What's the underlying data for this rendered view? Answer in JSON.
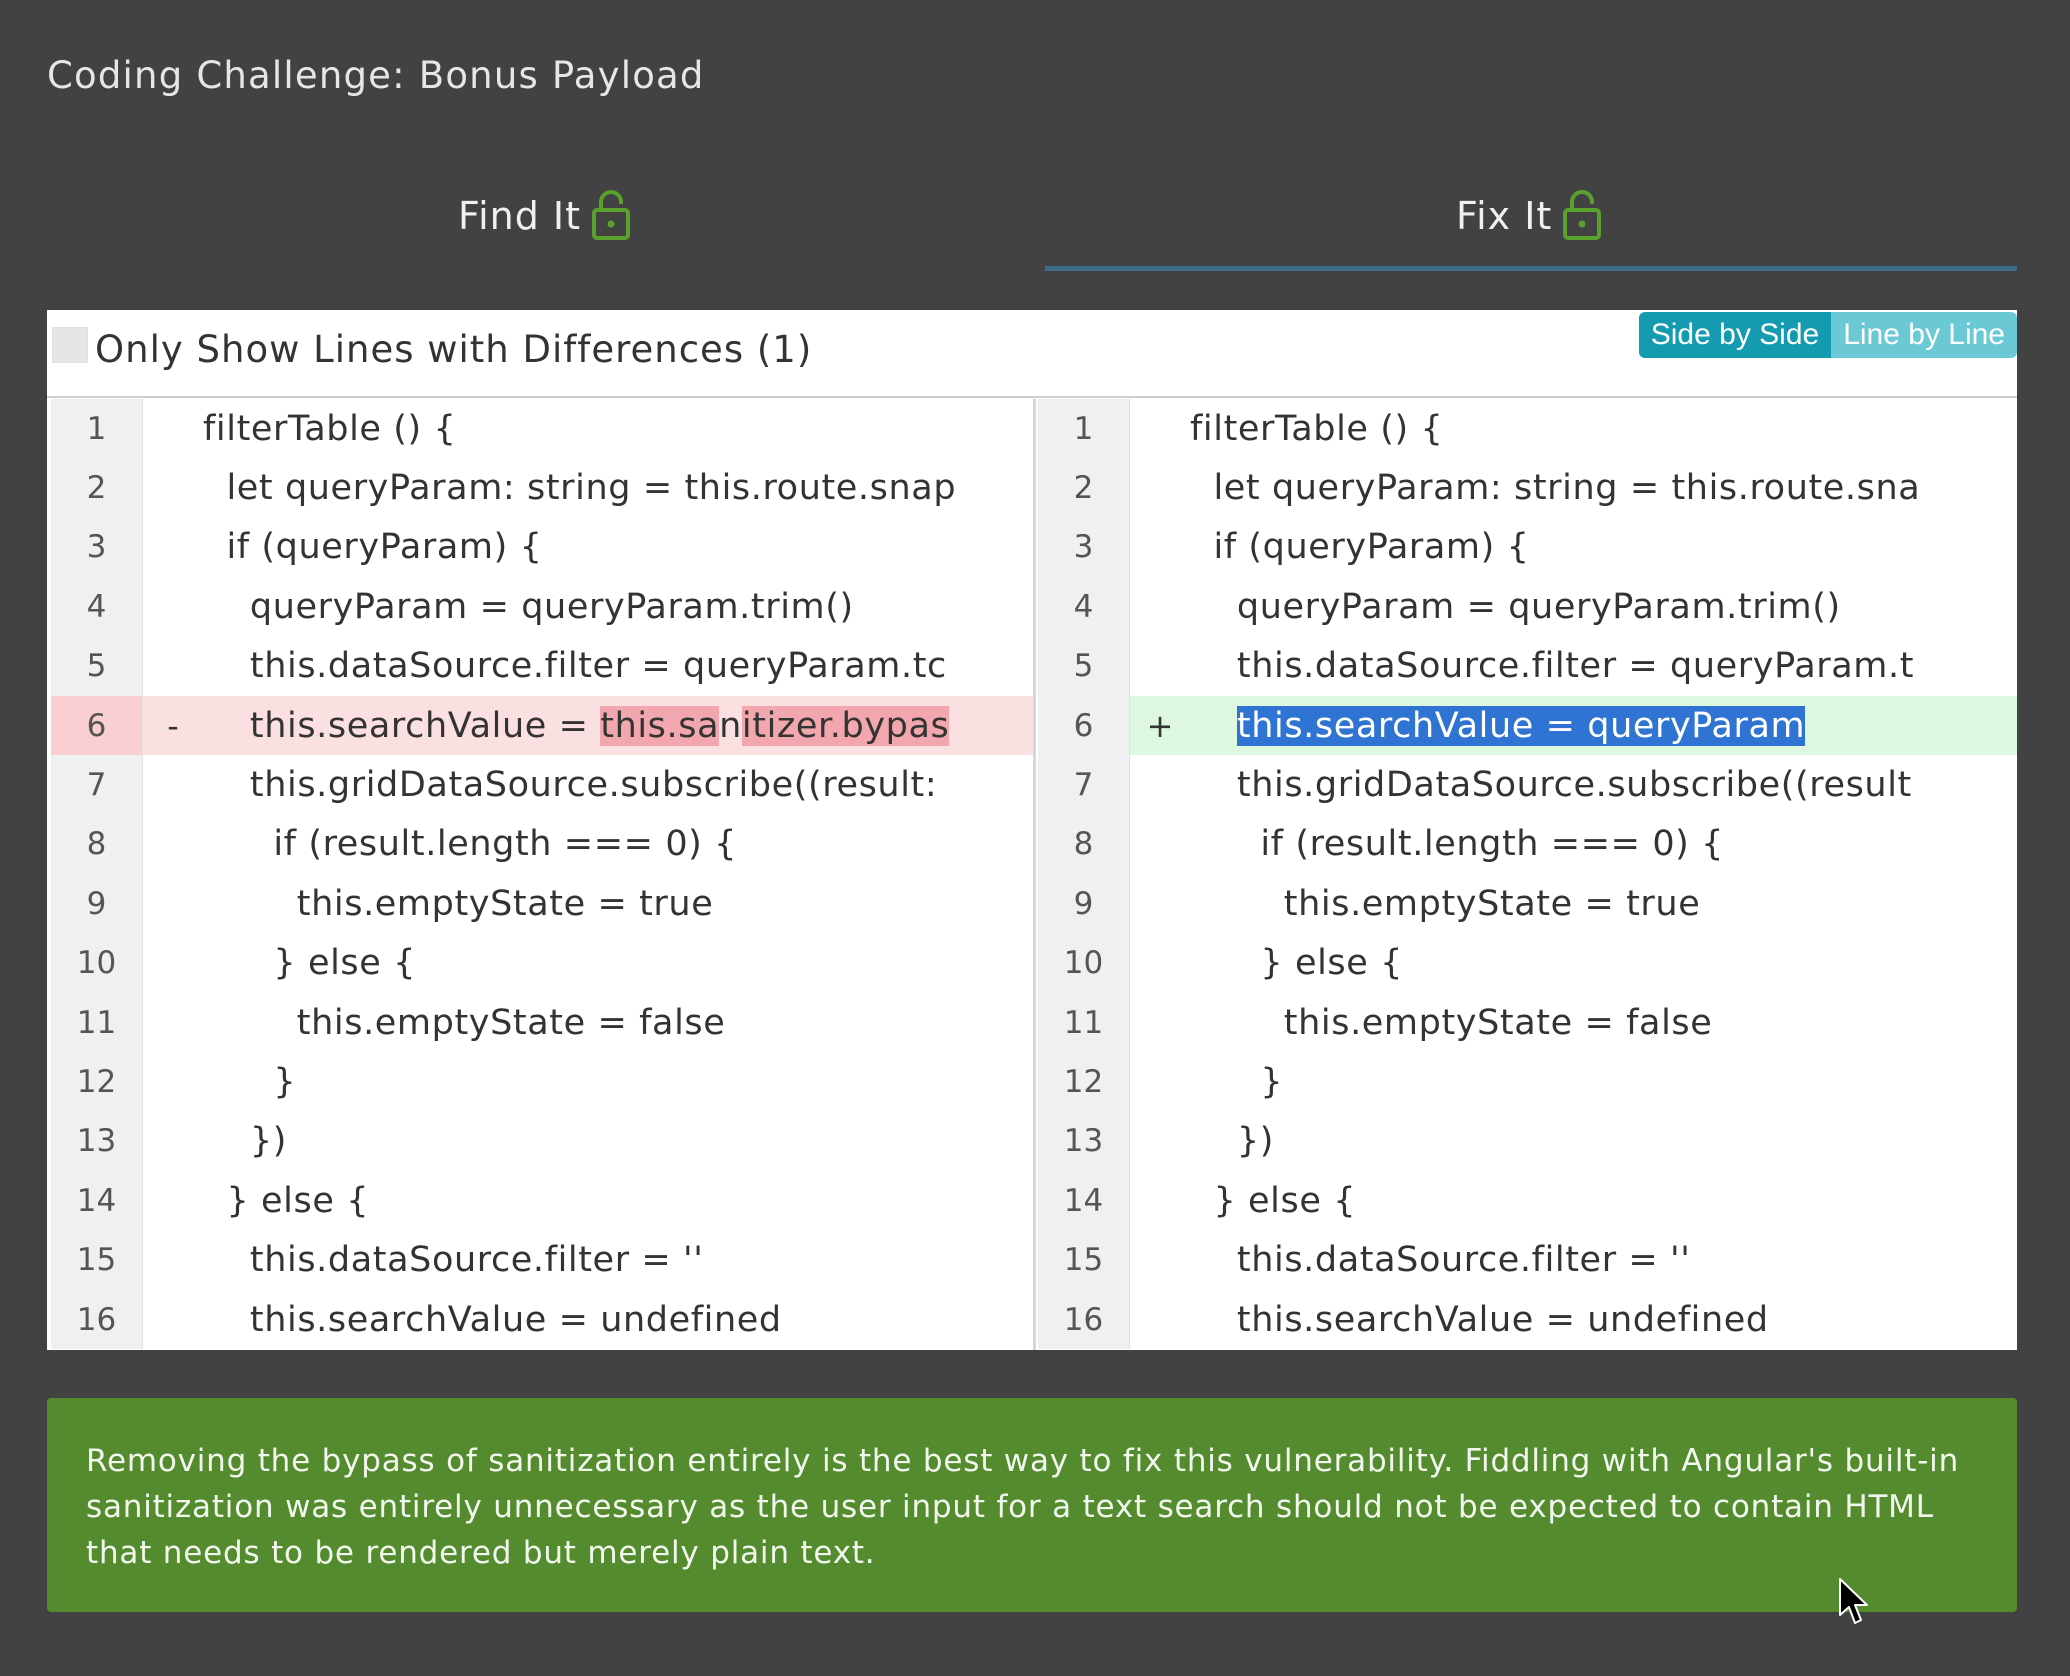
{
  "title": "Coding Challenge: Bonus Payload",
  "tabs": [
    {
      "label": "Find It",
      "icon": "lock-open-icon"
    },
    {
      "label": "Fix It",
      "icon": "lock-open-icon"
    }
  ],
  "diff": {
    "only_diff_label": "Only Show Lines with Differences (1)",
    "modes": {
      "side_by_side": "Side by Side",
      "line_by_line": "Line by Line"
    },
    "left_rows": [
      {
        "n": "1",
        "code": "filterTable () {"
      },
      {
        "n": "2",
        "code": "  let queryParam: string = this.route.snap"
      },
      {
        "n": "3",
        "code": "  if (queryParam) {"
      },
      {
        "n": "4",
        "code": "    queryParam = queryParam.trim()"
      },
      {
        "n": "5",
        "code": "    this.dataSource.filter = queryParam.tc"
      },
      {
        "n": "6",
        "marker": "-",
        "pre": "    this.searchValue = ",
        "h1": "this.sa",
        "mid": "n",
        "h2": "itizer.bypas"
      },
      {
        "n": "7",
        "code": "    this.gridDataSource.subscribe((result:"
      },
      {
        "n": "8",
        "code": "      if (result.length === 0) {"
      },
      {
        "n": "9",
        "code": "        this.emptyState = true"
      },
      {
        "n": "10",
        "code": "      } else {"
      },
      {
        "n": "11",
        "code": "        this.emptyState = false"
      },
      {
        "n": "12",
        "code": "      }"
      },
      {
        "n": "13",
        "code": "    })"
      },
      {
        "n": "14",
        "code": "  } else {"
      },
      {
        "n": "15",
        "code": "    this.dataSource.filter = ''"
      },
      {
        "n": "16",
        "code": "    this.searchValue = undefined"
      }
    ],
    "right_rows": [
      {
        "n": "1",
        "code": "filterTable () {"
      },
      {
        "n": "2",
        "code": "  let queryParam: string = this.route.sna"
      },
      {
        "n": "3",
        "code": "  if (queryParam) {"
      },
      {
        "n": "4",
        "code": "    queryParam = queryParam.trim()"
      },
      {
        "n": "5",
        "code": "    this.dataSource.filter = queryParam.t"
      },
      {
        "n": "6",
        "marker": "+",
        "pre": "    ",
        "sel": "this.searchValue = queryParam"
      },
      {
        "n": "7",
        "code": "    this.gridDataSource.subscribe((result"
      },
      {
        "n": "8",
        "code": "      if (result.length === 0) {"
      },
      {
        "n": "9",
        "code": "        this.emptyState = true"
      },
      {
        "n": "10",
        "code": "      } else {"
      },
      {
        "n": "11",
        "code": "        this.emptyState = false"
      },
      {
        "n": "12",
        "code": "      }"
      },
      {
        "n": "13",
        "code": "    })"
      },
      {
        "n": "14",
        "code": "  } else {"
      },
      {
        "n": "15",
        "code": "    this.dataSource.filter = ''"
      },
      {
        "n": "16",
        "code": "    this.searchValue = undefined"
      }
    ]
  },
  "explanation": "Removing the bypass of sanitization entirely is the best way to fix this vulnerability. Fiddling with Angular's built-in sanitization was entirely unnecessary as the user input for a text search should not be expected to contain HTML that needs to be rendered but merely plain text.",
  "colors": {
    "background": "#424242",
    "success": "#558b2f",
    "tab_underline": "#3e6b86",
    "lock_icon": "#5aa02c"
  }
}
